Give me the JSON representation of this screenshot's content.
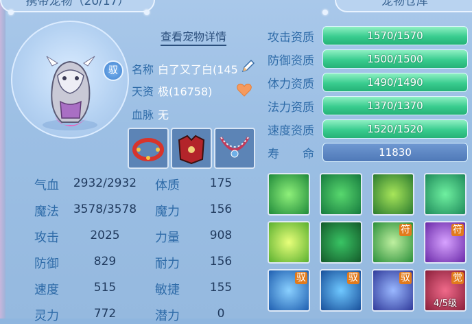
{
  "top_tabs": {
    "left": "携带宠物（20/17）",
    "right": "宠物仓库"
  },
  "portrait": {
    "badge": "驭"
  },
  "detail_link": "查看宠物详情",
  "info": {
    "name_label": "名称",
    "name_value": "白了又了白(145",
    "aptitude_label": "天资",
    "aptitude_value": "极(16758)",
    "bloodline_label": "血脉",
    "bloodline_value": "无"
  },
  "stats": [
    {
      "k1": "气血",
      "v1": "2932/2932",
      "k2": "体质",
      "v2": "175"
    },
    {
      "k1": "魔法",
      "v1": "3578/3578",
      "k2": "魔力",
      "v2": "156"
    },
    {
      "k1": "攻击",
      "v1": "2025",
      "k2": "力量",
      "v2": "908"
    },
    {
      "k1": "防御",
      "v1": "829",
      "k2": "耐力",
      "v2": "156"
    },
    {
      "k1": "速度",
      "v1": "515",
      "k2": "敏捷",
      "v2": "155"
    },
    {
      "k1": "灵力",
      "v1": "772",
      "k2": "潜力",
      "v2": "0"
    }
  ],
  "attributes": [
    {
      "label": "攻击资质",
      "value": "1570/1570"
    },
    {
      "label": "防御资质",
      "value": "1500/1500"
    },
    {
      "label": "体力资质",
      "value": "1490/1490"
    },
    {
      "label": "法力资质",
      "value": "1370/1370"
    },
    {
      "label": "速度资质",
      "value": "1520/1520"
    },
    {
      "label": "寿　　命",
      "value": "11830"
    }
  ],
  "skills": [
    {
      "name": "wings-skill-icon",
      "tag": "",
      "lvl": ""
    },
    {
      "name": "strength-figure-skill-icon",
      "tag": "",
      "lvl": ""
    },
    {
      "name": "warrior-strike-skill-icon",
      "tag": "",
      "lvl": ""
    },
    {
      "name": "dash-runner-skill-icon",
      "tag": "",
      "lvl": ""
    },
    {
      "name": "heart-skill-icon",
      "tag": "",
      "lvl": ""
    },
    {
      "name": "claw-grab-skill-icon",
      "tag": "",
      "lvl": ""
    },
    {
      "name": "sword-skill-icon",
      "tag": "符",
      "lvl": ""
    },
    {
      "name": "thunder-skill-icon",
      "tag": "符",
      "lvl": ""
    },
    {
      "name": "shield-skill-icon",
      "tag": "驭",
      "lvl": ""
    },
    {
      "name": "water-vortex-skill-icon",
      "tag": "驭",
      "lvl": ""
    },
    {
      "name": "ice-shard-skill-icon",
      "tag": "驭",
      "lvl": ""
    },
    {
      "name": "awaken-skill-icon",
      "tag": "觉",
      "lvl": "4/5级"
    }
  ],
  "colors": {
    "bar_green": "#39cc8f",
    "bar_blue": "#4f79b8",
    "label_blue": "#2e6ba8"
  }
}
